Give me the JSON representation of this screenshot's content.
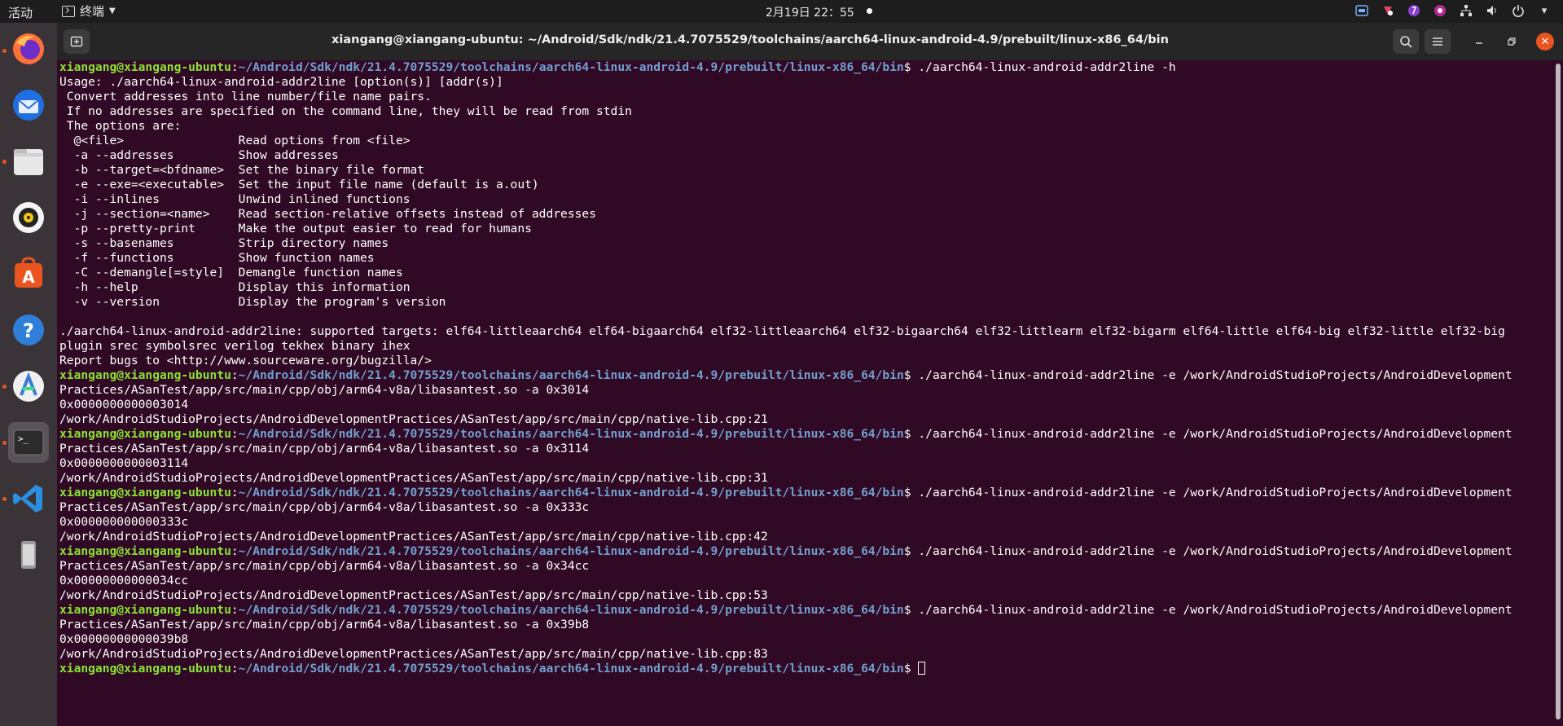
{
  "topbar": {
    "activities": "活动",
    "app_name": "终端",
    "clock": "2月19日  22：55"
  },
  "dock": {
    "items": [
      {
        "name": "firefox-icon",
        "running": true
      },
      {
        "name": "thunderbird-icon",
        "running": false
      },
      {
        "name": "files-icon",
        "running": true
      },
      {
        "name": "rhythmbox-icon",
        "running": false
      },
      {
        "name": "software-store-icon",
        "running": false
      },
      {
        "name": "help-icon",
        "running": false
      },
      {
        "name": "android-studio-icon",
        "running": true
      },
      {
        "name": "terminal-icon",
        "running": true
      },
      {
        "name": "vscode-icon",
        "running": true
      },
      {
        "name": "device-icon",
        "running": false
      }
    ]
  },
  "window": {
    "title": "xiangang@xiangang-ubuntu: ~/Android/Sdk/ndk/21.4.7075529/toolchains/aarch64-linux-android-4.9/prebuilt/linux-x86_64/bin"
  },
  "terminal": {
    "prompt_user": "xiangang@xiangang-ubuntu",
    "prompt_path": "~/Android/Sdk/ndk/21.4.7075529/toolchains/aarch64-linux-android-4.9/prebuilt/linux-x86_64/bin",
    "lines": [
      {
        "t": "prompt",
        "cmd": " ./aarch64-linux-android-addr2line -h"
      },
      {
        "t": "out",
        "text": "Usage: ./aarch64-linux-android-addr2line [option(s)] [addr(s)]"
      },
      {
        "t": "out",
        "text": " Convert addresses into line number/file name pairs."
      },
      {
        "t": "out",
        "text": " If no addresses are specified on the command line, they will be read from stdin"
      },
      {
        "t": "out",
        "text": " The options are:"
      },
      {
        "t": "out",
        "text": "  @<file>                Read options from <file>"
      },
      {
        "t": "out",
        "text": "  -a --addresses         Show addresses"
      },
      {
        "t": "out",
        "text": "  -b --target=<bfdname>  Set the binary file format"
      },
      {
        "t": "out",
        "text": "  -e --exe=<executable>  Set the input file name (default is a.out)"
      },
      {
        "t": "out",
        "text": "  -i --inlines           Unwind inlined functions"
      },
      {
        "t": "out",
        "text": "  -j --section=<name>    Read section-relative offsets instead of addresses"
      },
      {
        "t": "out",
        "text": "  -p --pretty-print      Make the output easier to read for humans"
      },
      {
        "t": "out",
        "text": "  -s --basenames         Strip directory names"
      },
      {
        "t": "out",
        "text": "  -f --functions         Show function names"
      },
      {
        "t": "out",
        "text": "  -C --demangle[=style]  Demangle function names"
      },
      {
        "t": "out",
        "text": "  -h --help              Display this information"
      },
      {
        "t": "out",
        "text": "  -v --version           Display the program's version"
      },
      {
        "t": "out",
        "text": ""
      },
      {
        "t": "out",
        "text": "./aarch64-linux-android-addr2line: supported targets: elf64-littleaarch64 elf64-bigaarch64 elf32-littleaarch64 elf32-bigaarch64 elf32-littlearm elf32-bigarm elf64-little elf64-big elf32-little elf32-big"
      },
      {
        "t": "out",
        "text": "plugin srec symbolsrec verilog tekhex binary ihex"
      },
      {
        "t": "out",
        "text": "Report bugs to <http://www.sourceware.org/bugzilla/>"
      },
      {
        "t": "prompt",
        "cmd": " ./aarch64-linux-android-addr2line -e /work/AndroidStudioProjects/AndroidDevelopment"
      },
      {
        "t": "out",
        "text": "Practices/ASanTest/app/src/main/cpp/obj/arm64-v8a/libasantest.so -a 0x3014"
      },
      {
        "t": "out",
        "text": "0x0000000000003014"
      },
      {
        "t": "out",
        "text": "/work/AndroidStudioProjects/AndroidDevelopmentPractices/ASanTest/app/src/main/cpp/native-lib.cpp:21"
      },
      {
        "t": "prompt",
        "cmd": " ./aarch64-linux-android-addr2line -e /work/AndroidStudioProjects/AndroidDevelopment"
      },
      {
        "t": "out",
        "text": "Practices/ASanTest/app/src/main/cpp/obj/arm64-v8a/libasantest.so -a 0x3114"
      },
      {
        "t": "out",
        "text": "0x0000000000003114"
      },
      {
        "t": "out",
        "text": "/work/AndroidStudioProjects/AndroidDevelopmentPractices/ASanTest/app/src/main/cpp/native-lib.cpp:31"
      },
      {
        "t": "prompt",
        "cmd": " ./aarch64-linux-android-addr2line -e /work/AndroidStudioProjects/AndroidDevelopment"
      },
      {
        "t": "out",
        "text": "Practices/ASanTest/app/src/main/cpp/obj/arm64-v8a/libasantest.so -a 0x333c"
      },
      {
        "t": "out",
        "text": "0x000000000000333c"
      },
      {
        "t": "out",
        "text": "/work/AndroidStudioProjects/AndroidDevelopmentPractices/ASanTest/app/src/main/cpp/native-lib.cpp:42"
      },
      {
        "t": "prompt",
        "cmd": " ./aarch64-linux-android-addr2line -e /work/AndroidStudioProjects/AndroidDevelopment"
      },
      {
        "t": "out",
        "text": "Practices/ASanTest/app/src/main/cpp/obj/arm64-v8a/libasantest.so -a 0x34cc"
      },
      {
        "t": "out",
        "text": "0x00000000000034cc"
      },
      {
        "t": "out",
        "text": "/work/AndroidStudioProjects/AndroidDevelopmentPractices/ASanTest/app/src/main/cpp/native-lib.cpp:53"
      },
      {
        "t": "prompt",
        "cmd": " ./aarch64-linux-android-addr2line -e /work/AndroidStudioProjects/AndroidDevelopment"
      },
      {
        "t": "out",
        "text": "Practices/ASanTest/app/src/main/cpp/obj/arm64-v8a/libasantest.so -a 0x39b8"
      },
      {
        "t": "out",
        "text": "0x00000000000039b8"
      },
      {
        "t": "out",
        "text": "/work/AndroidStudioProjects/AndroidDevelopmentPractices/ASanTest/app/src/main/cpp/native-lib.cpp:83"
      },
      {
        "t": "prompt",
        "cmd": " ",
        "cursor": true
      }
    ]
  },
  "colors": {
    "terminal_bg": "#300a24",
    "prompt_user": "#8ae234",
    "prompt_path": "#729fcf",
    "accent": "#e95420"
  }
}
